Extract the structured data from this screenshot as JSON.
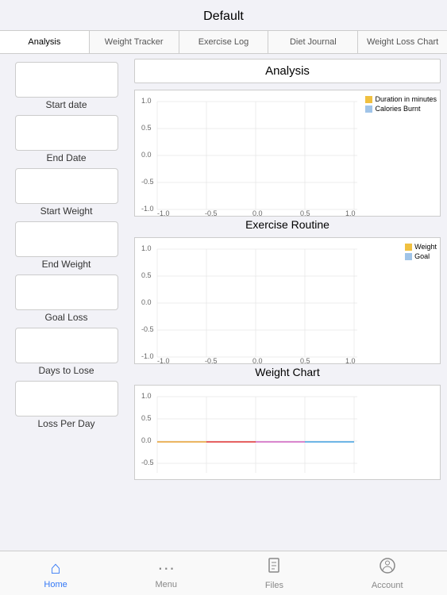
{
  "header": {
    "title": "Default"
  },
  "tabs": [
    {
      "label": "Analysis",
      "active": true
    },
    {
      "label": "Weight Tracker",
      "active": false
    },
    {
      "label": "Exercise Log",
      "active": false
    },
    {
      "label": "Diet Journal",
      "active": false
    },
    {
      "label": "Weight Loss Chart",
      "active": false
    }
  ],
  "analysis_title": "Analysis",
  "input_fields": [
    {
      "label": "Start date"
    },
    {
      "label": "End Date"
    },
    {
      "label": "Start Weight"
    },
    {
      "label": "End Weight"
    },
    {
      "label": "Goal Loss"
    },
    {
      "label": "Days to Lose"
    },
    {
      "label": "Loss Per Day"
    }
  ],
  "charts": [
    {
      "id": "exercise",
      "title": "Exercise Routine",
      "legend": [
        {
          "color": "#f0c040",
          "label": "Duration in minutes"
        },
        {
          "color": "#a0c4e8",
          "label": "Calories Burnt"
        }
      ]
    },
    {
      "id": "weight",
      "title": "Weight Chart",
      "legend": [
        {
          "color": "#f0c040",
          "label": "Weight"
        },
        {
          "color": "#a0c4e8",
          "label": "Goal"
        }
      ]
    },
    {
      "id": "diet",
      "title": "",
      "legend": []
    }
  ],
  "bottom_nav": [
    {
      "label": "Home",
      "icon": "home",
      "active": true
    },
    {
      "label": "Menu",
      "icon": "menu",
      "active": false
    },
    {
      "label": "Files",
      "icon": "files",
      "active": false
    },
    {
      "label": "Account",
      "icon": "account",
      "active": false
    }
  ]
}
